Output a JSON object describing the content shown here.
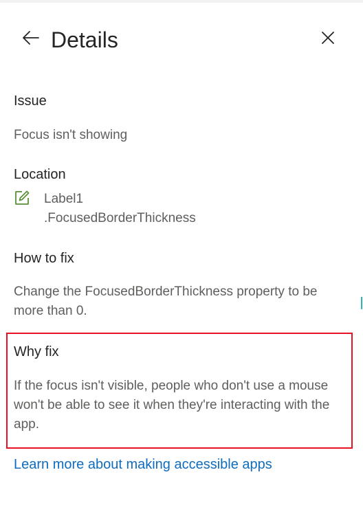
{
  "header": {
    "back_icon": "arrow-left-icon",
    "title": "Details",
    "close_icon": "close-icon"
  },
  "issue": {
    "label": "Issue",
    "text": "Focus isn't showing"
  },
  "location": {
    "label": "Location",
    "icon": "edit-icon",
    "control": "Label1",
    "property": ".FocusedBorderThickness"
  },
  "how_to_fix": {
    "label": "How to fix",
    "text": "Change the FocusedBorderThickness property to be more than 0."
  },
  "why_fix": {
    "label": "Why fix",
    "text": "If the focus isn't visible, people who don't use a mouse won't be able to see it when they're interacting with the app.",
    "highlight_color": "#e81123"
  },
  "learn_more": {
    "label": "Learn more about making accessible apps",
    "color": "#0f6cbd"
  }
}
